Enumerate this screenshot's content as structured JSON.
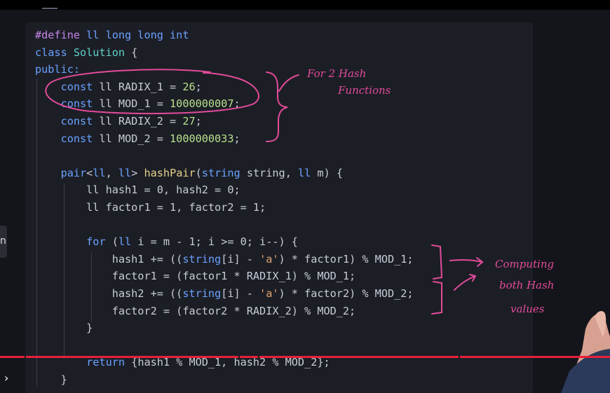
{
  "code": {
    "line1": {
      "pp": "#define",
      "rest": " ll long long int"
    },
    "line2": {
      "kw": "class",
      "cls": "Solution",
      "brace": " {"
    },
    "line3": {
      "kw": "public:"
    },
    "line4": {
      "kw": "const",
      "id": " ll RADIX_1 = ",
      "num": "26",
      "end": ";"
    },
    "line5": {
      "kw": "const",
      "id": " ll MOD_1 = ",
      "num": "1000000007",
      "end": ";"
    },
    "line6": {
      "kw": "const",
      "id": " ll RADIX_2 = ",
      "num": "27",
      "end": ";"
    },
    "line7": {
      "kw": "const",
      "id": " ll MOD_2 = ",
      "num": "1000000033",
      "end": ";"
    },
    "line8": {
      "ty1": "pair",
      "a": "<",
      "ty2": "ll",
      "b": ", ",
      "ty3": "ll",
      "c": "> ",
      "fn": "hashPair",
      "d": "(",
      "ty4": "string",
      "e": " string, ",
      "ty5": "ll",
      "f": " m) {"
    },
    "line9": "ll hash1 = 0, hash2 = 0;",
    "line10": "ll factor1 = 1, factor2 = 1;",
    "line11": {
      "kw": "for",
      "a": " (",
      "ty": "ll",
      "b": " i = m - 1; i >= 0; i--) {"
    },
    "line12": {
      "a": "hash1 += ((",
      "ty": "string",
      "b": "[i] - ",
      "str": "'a'",
      "c": ") * factor1) % MOD_1;"
    },
    "line13": "factor1 = (factor1 * RADIX_1) % MOD_1;",
    "line14": {
      "a": "hash2 += ((",
      "ty": "string",
      "b": "[i] - ",
      "str": "'a'",
      "c": ") * factor2) % MOD_2;"
    },
    "line15": "factor2 = (factor2 * RADIX_2) % MOD_2;",
    "line16": "}",
    "line17": {
      "kw": "return",
      "rest": " {hash1 % MOD_1, hash2 % MOD_2};"
    },
    "line18": "}"
  },
  "annotations": {
    "note1_line1": "For 2 Hash",
    "note1_line2": "Functions",
    "note2_line1": "Computing",
    "note2_line2": "both Hash",
    "note2_line3": "values"
  },
  "player": {
    "side_handle": "n",
    "chevron": "›"
  },
  "colors": {
    "editor_bg": "#1c1e26",
    "annotation": "#e24b9a",
    "progress": "#e8203a"
  }
}
